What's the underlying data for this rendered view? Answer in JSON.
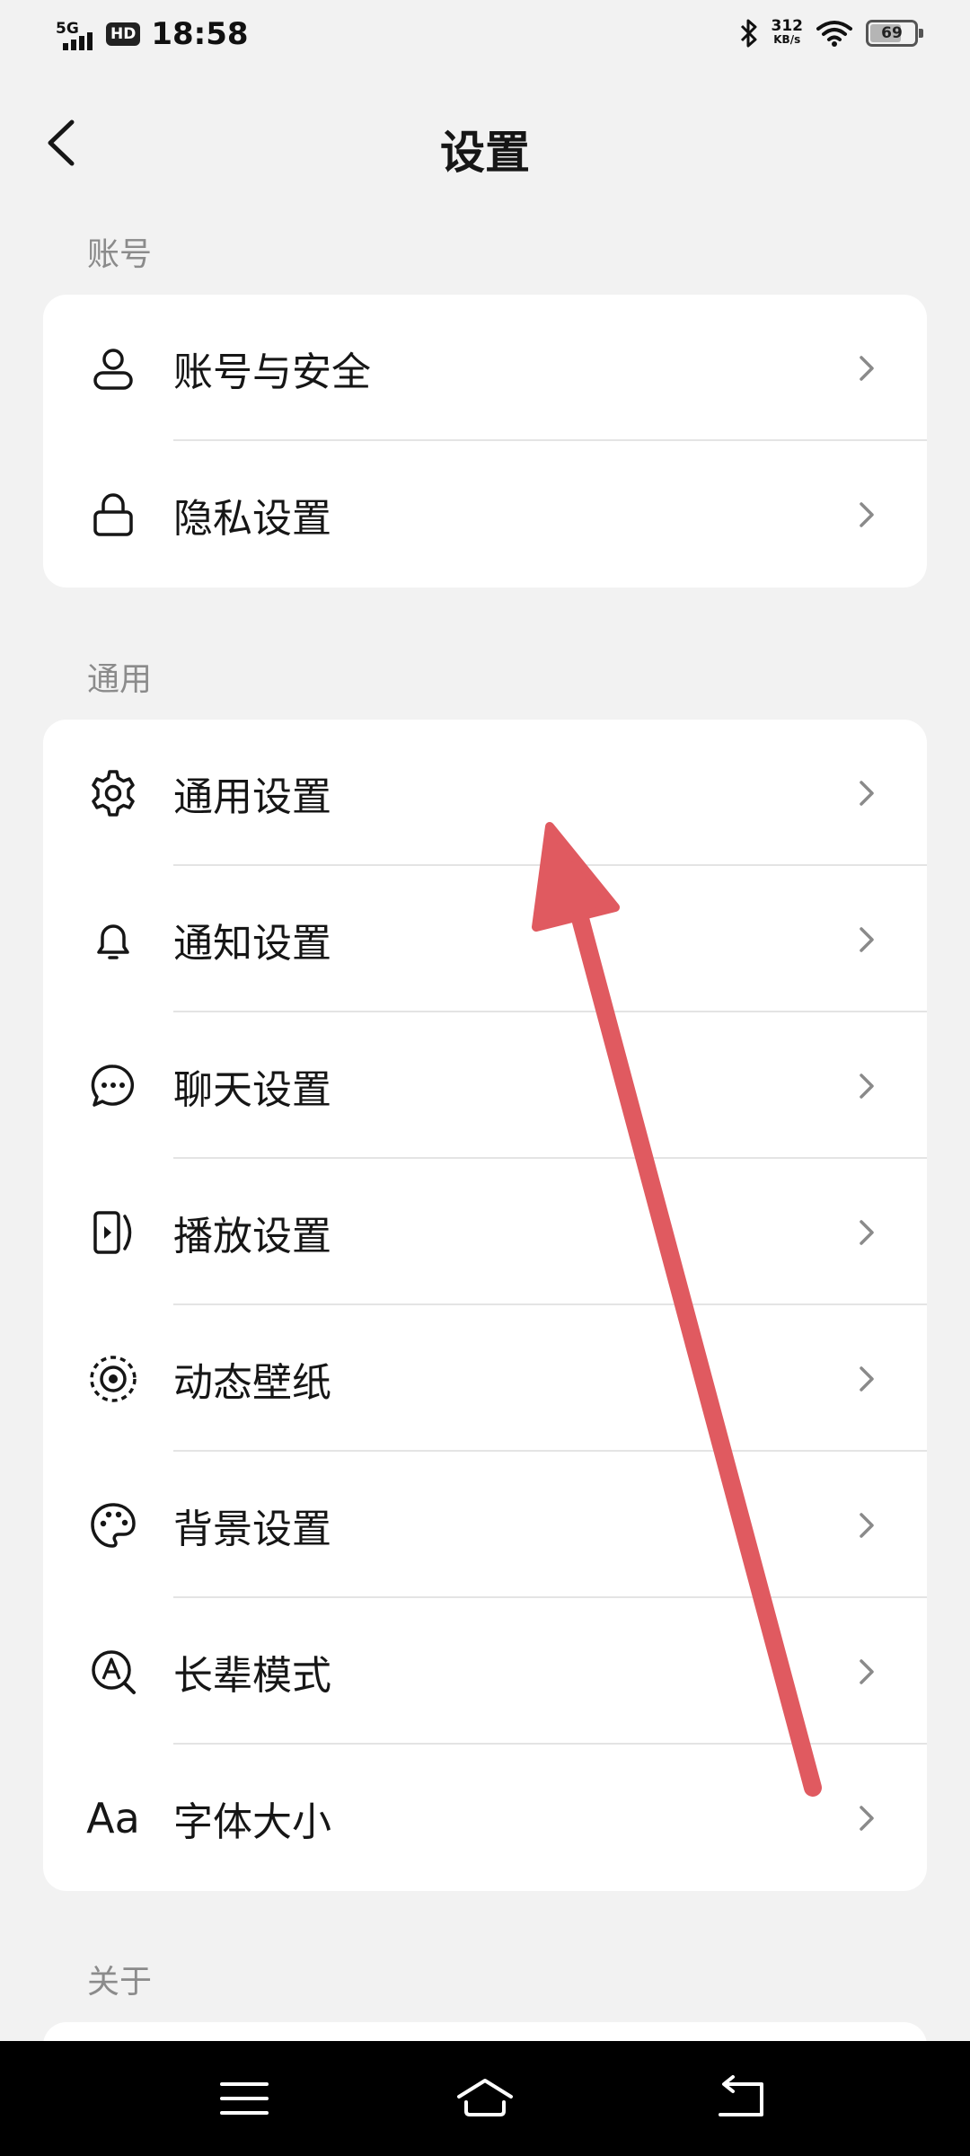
{
  "status_bar": {
    "network": "5G",
    "hd": "HD",
    "time": "18:58",
    "speed_value": "312",
    "speed_unit": "KB/s",
    "battery": "69"
  },
  "header": {
    "title": "设置"
  },
  "sections": [
    {
      "label": "账号",
      "items": [
        {
          "label": "账号与安全",
          "icon": "user-icon"
        },
        {
          "label": "隐私设置",
          "icon": "lock-icon"
        }
      ]
    },
    {
      "label": "通用",
      "items": [
        {
          "label": "通用设置",
          "icon": "gear-icon"
        },
        {
          "label": "通知设置",
          "icon": "bell-icon"
        },
        {
          "label": "聊天设置",
          "icon": "chat-bubble-icon"
        },
        {
          "label": "播放设置",
          "icon": "play-icon"
        },
        {
          "label": "动态壁纸",
          "icon": "live-wallpaper-icon"
        },
        {
          "label": "背景设置",
          "icon": "palette-icon"
        },
        {
          "label": "长辈模式",
          "icon": "elder-mode-icon"
        },
        {
          "label": "字体大小",
          "icon": "font-size-icon",
          "icon_text": "Aa"
        }
      ]
    },
    {
      "label": "关于",
      "items": []
    }
  ],
  "annotation": {
    "color": "#e05a60",
    "icon": "red-arrow-icon"
  }
}
